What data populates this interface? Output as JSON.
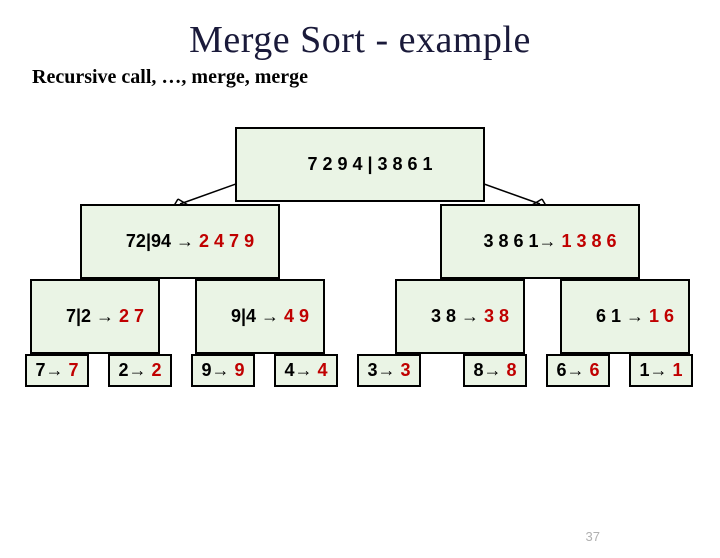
{
  "title": "Merge Sort - example",
  "subtitle": "Recursive call, …, merge, merge",
  "page_number": "37",
  "nodes": {
    "root": {
      "input": "7 2 9 4 | 3 8 6 1",
      "arrow": "",
      "out": ""
    },
    "l": {
      "input": "72|94",
      "arrow": " → ",
      "out": "2 4 7 9"
    },
    "r": {
      "input": "3 8 6 1",
      "arrow": "→ ",
      "out": "1 3 8 6"
    },
    "ll": {
      "input": "7|2",
      "arrow": " → ",
      "out": "2 7"
    },
    "lr": {
      "input": "9|4",
      "arrow": " → ",
      "out": "4 9"
    },
    "rl": {
      "input": "3 8",
      "arrow": " → ",
      "out": "3 8"
    },
    "rr": {
      "input": "6 1",
      "arrow": " → ",
      "out": "1 6"
    },
    "n7": {
      "input": "7",
      "arrow": "→ ",
      "out": "7"
    },
    "n2": {
      "input": "2",
      "arrow": "→ ",
      "out": "2"
    },
    "n9": {
      "input": "9",
      "arrow": "→ ",
      "out": "9"
    },
    "n4": {
      "input": "4",
      "arrow": "→ ",
      "out": "4"
    },
    "n3": {
      "input": "3",
      "arrow": "→ ",
      "out": "3"
    },
    "n8": {
      "input": "8",
      "arrow": "→ ",
      "out": "8"
    },
    "n6": {
      "input": "6",
      "arrow": "→ ",
      "out": "6"
    },
    "n1": {
      "input": "1",
      "arrow": "→ ",
      "out": "1"
    }
  }
}
